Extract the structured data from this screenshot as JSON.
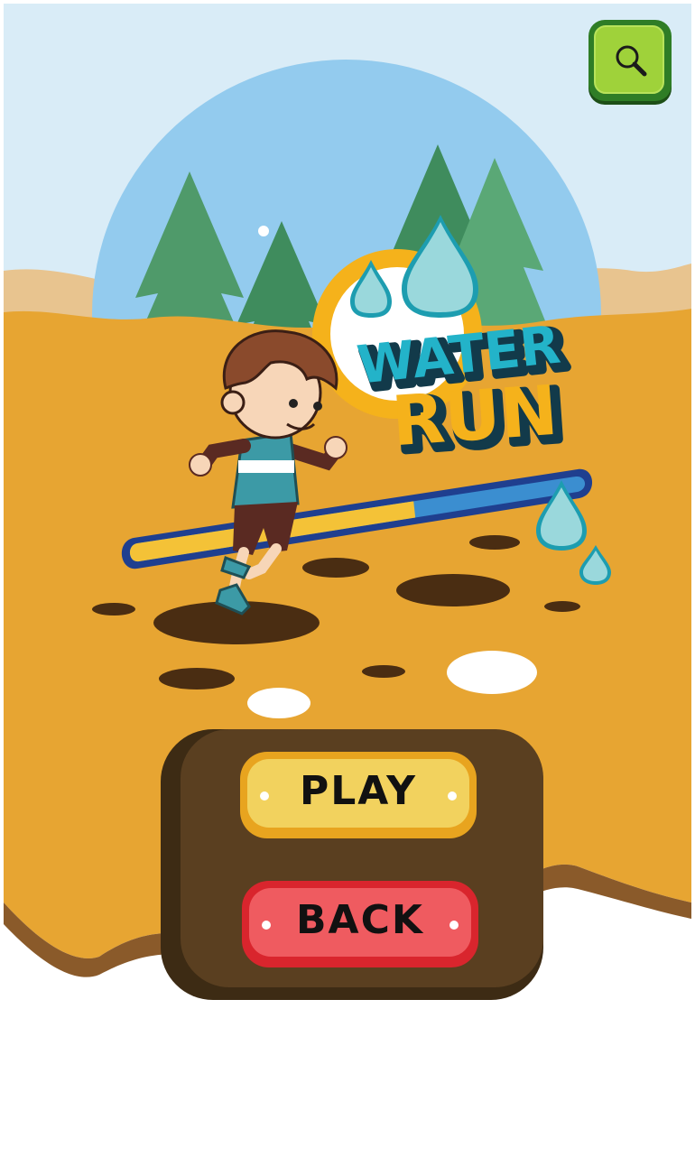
{
  "game": {
    "title_line1": "WATER",
    "title_line2": "RUN"
  },
  "buttons": {
    "play_label": "PLAY",
    "back_label": "BACK"
  },
  "icons": {
    "search": "search-icon"
  },
  "colors": {
    "sky": "#d9ecf7",
    "sun_circle": "#93cbee",
    "ground": "#e7a532",
    "play_button": "#f2d25e",
    "back_button": "#ef5b60",
    "search_button": "#9fd23a",
    "title_blue": "#23b3c9",
    "title_yellow": "#f5b21b"
  },
  "water_meter": {
    "fill_fraction": 0.63
  }
}
